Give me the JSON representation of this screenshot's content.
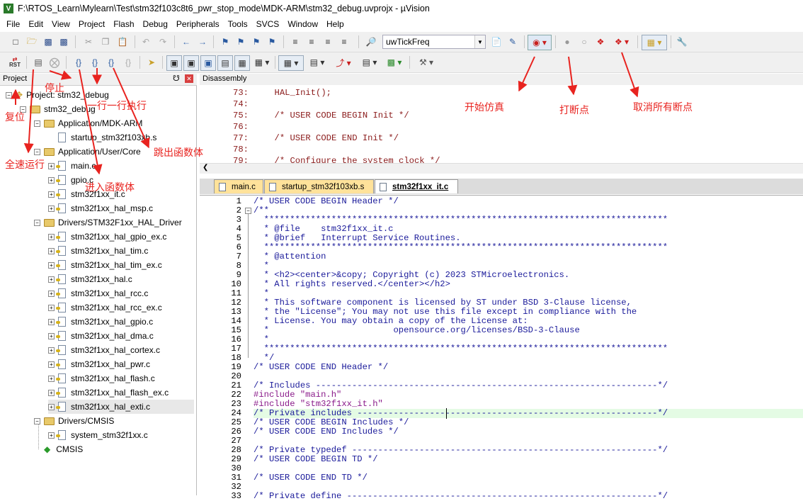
{
  "window": {
    "title": "F:\\RTOS_Learn\\Mylearn\\Test\\stm32f103c8t6_pwr_stop_mode\\MDK-ARM\\stm32_debug.uvprojx - µVision",
    "app_icon": "V"
  },
  "menu": [
    "File",
    "Edit",
    "View",
    "Project",
    "Flash",
    "Debug",
    "Peripherals",
    "Tools",
    "SVCS",
    "Window",
    "Help"
  ],
  "toolbar1": {
    "find_combo_value": "uwTickFreq"
  },
  "toolbar2": {
    "rst_label": "RST"
  },
  "project_pane": {
    "header": "Project",
    "pin": "ᵖ",
    "close": "✕",
    "tree": [
      {
        "label": "Project: stm32_debug",
        "type": "root"
      },
      {
        "label": "stm32_debug",
        "type": "folder"
      },
      {
        "label": "Application/MDK-ARM",
        "type": "folder"
      },
      {
        "label": "startup_stm32f103xb.s",
        "type": "file"
      },
      {
        "label": "Application/User/Core",
        "type": "folder"
      },
      {
        "label": "main.c",
        "type": "file"
      },
      {
        "label": "gpio.c",
        "type": "file"
      },
      {
        "label": "stm32f1xx_it.c",
        "type": "file"
      },
      {
        "label": "stm32f1xx_hal_msp.c",
        "type": "file"
      },
      {
        "label": "Drivers/STM32F1xx_HAL_Driver",
        "type": "folder"
      },
      {
        "label": "stm32f1xx_hal_gpio_ex.c",
        "type": "file"
      },
      {
        "label": "stm32f1xx_hal_tim.c",
        "type": "file"
      },
      {
        "label": "stm32f1xx_hal_tim_ex.c",
        "type": "file"
      },
      {
        "label": "stm32f1xx_hal.c",
        "type": "file"
      },
      {
        "label": "stm32f1xx_hal_rcc.c",
        "type": "file"
      },
      {
        "label": "stm32f1xx_hal_rcc_ex.c",
        "type": "file"
      },
      {
        "label": "stm32f1xx_hal_gpio.c",
        "type": "file"
      },
      {
        "label": "stm32f1xx_hal_dma.c",
        "type": "file"
      },
      {
        "label": "stm32f1xx_hal_cortex.c",
        "type": "file"
      },
      {
        "label": "stm32f1xx_hal_pwr.c",
        "type": "file"
      },
      {
        "label": "stm32f1xx_hal_flash.c",
        "type": "file"
      },
      {
        "label": "stm32f1xx_hal_flash_ex.c",
        "type": "file"
      },
      {
        "label": "stm32f1xx_hal_exti.c",
        "type": "file"
      },
      {
        "label": "Drivers/CMSIS",
        "type": "folder"
      },
      {
        "label": "system_stm32f1xx.c",
        "type": "file"
      },
      {
        "label": "CMSIS",
        "type": "component"
      }
    ]
  },
  "disassembly": {
    "header": "Disassembly",
    "lines": [
      "73:     HAL_Init();",
      "74:",
      "75:     /* USER CODE BEGIN Init */",
      "76:",
      "77:     /* USER CODE END Init */",
      "78:",
      "79:     /* Configure the system clock */"
    ]
  },
  "tabs": [
    "main.c",
    "startup_stm32f103xb.s",
    "stm32f1xx_it.c"
  ],
  "editor": {
    "line_numbers": [
      "1",
      "2",
      "3",
      "4",
      "5",
      "6",
      "7",
      "8",
      "9",
      "10",
      "11",
      "12",
      "13",
      "14",
      "15",
      "16",
      "17",
      "18",
      "19",
      "20",
      "21",
      "22",
      "23",
      "24",
      "25",
      "26",
      "27",
      "28",
      "29",
      "30",
      "31",
      "32",
      "33"
    ],
    "lines": [
      "/* USER CODE BEGIN Header */",
      "/**",
      "  ******************************************************************************",
      "  * @file    stm32f1xx_it.c",
      "  * @brief   Interrupt Service Routines.",
      "  ******************************************************************************",
      "  * @attention",
      "  *",
      "  * <h2><center>&copy; Copyright (c) 2023 STMicroelectronics.",
      "  * All rights reserved.</center></h2>",
      "  *",
      "  * This software component is licensed by ST under BSD 3-Clause license,",
      "  * the \"License\"; You may not use this file except in compliance with the",
      "  * License. You may obtain a copy of the License at:",
      "  *                        opensource.org/licenses/BSD-3-Clause",
      "  *",
      "  ******************************************************************************",
      "  */",
      "/* USER CODE END Header */",
      "",
      "/* Includes ------------------------------------------------------------------*/",
      "#include \"main.h\"",
      "#include \"stm32f1xx_it.h\"",
      "/* Private includes ----------------------------------------------------------*/",
      "/* USER CODE BEGIN Includes */",
      "/* USER CODE END Includes */",
      "",
      "/* Private typedef -----------------------------------------------------------*/",
      "/* USER CODE BEGIN TD */",
      "",
      "/* USER CODE END TD */",
      "",
      "/* Private define ------------------------------------------------------------*/"
    ]
  },
  "annotations": {
    "reset": "复位",
    "stop": "停止",
    "step_line": "一行一行执行",
    "run": "全速运行",
    "step_out": "跳出函数体",
    "step_into": "进入函数体",
    "start_debug": "开始仿真",
    "breakpoint": "打断点",
    "clear_breakpoints": "取消所有断点"
  },
  "colors": {
    "annotation": "#e8231f",
    "code_comment": "#1a1a9a",
    "preprocessor": "#8a1a8a",
    "highlight_line": "#e4fbe4",
    "tab_inactive": "#ffe29a"
  }
}
